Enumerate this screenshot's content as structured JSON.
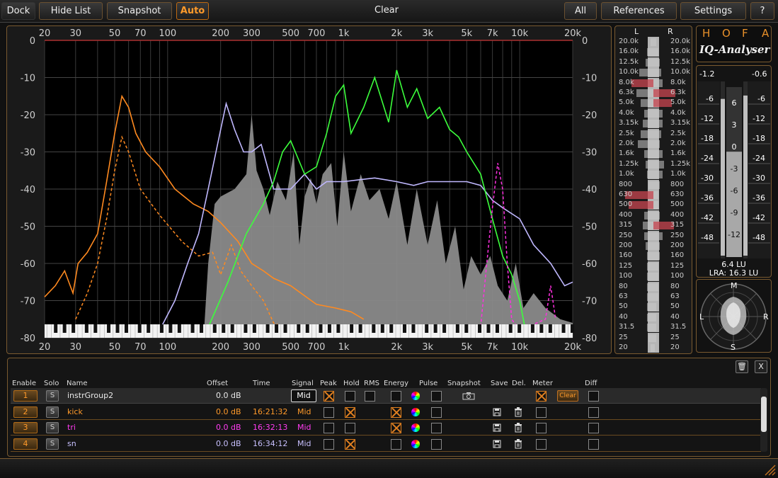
{
  "toolbar": {
    "dock": "Dock",
    "hide_list": "Hide List",
    "snapshot": "Snapshot",
    "auto": "Auto",
    "clear": "Clear",
    "all": "All",
    "references": "References",
    "settings": "Settings",
    "help": "?"
  },
  "analyzer": {
    "freq_labels": [
      "20",
      "30",
      "50",
      "70",
      "100",
      "200",
      "300",
      "500",
      "700",
      "1k",
      "2k",
      "3k",
      "5k",
      "7k",
      "10k",
      "20k"
    ],
    "db_labels": [
      "0",
      "-10",
      "-20",
      "-30",
      "-40",
      "-50",
      "-60",
      "-70",
      "-80"
    ]
  },
  "band_meter": {
    "left_label": "L",
    "right_label": "R",
    "bands": [
      "20.0k",
      "16.0k",
      "12.5k",
      "10.0k",
      "8.0k",
      "6.3k",
      "5.0k",
      "4.0k",
      "3.15k",
      "2.5k",
      "2.0k",
      "1.6k",
      "1.25k",
      "1.0k",
      "800",
      "630",
      "500",
      "400",
      "315",
      "250",
      "200",
      "160",
      "125",
      "100",
      "80",
      "63",
      "50",
      "40",
      "31.5",
      "25",
      "20"
    ],
    "left_levels": [
      0.1,
      0.2,
      0.25,
      0.45,
      0.7,
      0.55,
      0.4,
      0.3,
      0.35,
      0.4,
      0.5,
      0.3,
      0.25,
      0.2,
      0.15,
      0.9,
      0.8,
      0.3,
      0.35,
      0.3,
      0.25,
      0.2,
      0.2,
      0.2,
      0.2,
      0.2,
      0.2,
      0.2,
      0.2,
      0.15,
      0.1
    ],
    "right_levels": [
      0.1,
      0.15,
      0.2,
      0.25,
      0.3,
      0.7,
      0.6,
      0.3,
      0.3,
      0.25,
      0.2,
      0.3,
      0.35,
      0.3,
      0.2,
      0.15,
      0.15,
      0.2,
      0.65,
      0.3,
      0.2,
      0.2,
      0.15,
      0.15,
      0.15,
      0.15,
      0.1,
      0.1,
      0.1,
      0.1,
      0.05
    ],
    "left_peaks": [
      4,
      15,
      16
    ],
    "right_peaks": [
      5,
      6,
      18
    ]
  },
  "brand": {
    "letters": [
      "H",
      "O",
      "F",
      "A"
    ],
    "product": "IQ-Analyser"
  },
  "loudness": {
    "left_value": "-1.2",
    "right_value": "-0.6",
    "scale_outer": [
      "-6",
      "-12",
      "-18",
      "-24",
      "-30",
      "-36",
      "-42",
      "-48"
    ],
    "scale_inner": [
      "6",
      "3",
      "0",
      "-3",
      "-6",
      "-9",
      "-12"
    ],
    "lu_readout": "6.4 LU",
    "lra_readout": "LRA: 16.3 LU",
    "left_fill": 0.93,
    "right_fill": 0.95,
    "inner_fill": 0.62
  },
  "goniometer": {
    "m": "M",
    "s": "S",
    "l": "L",
    "r": "R"
  },
  "list": {
    "columns": [
      "Enable",
      "Solo",
      "Name",
      "Offset",
      "Time",
      "Signal",
      "Peak",
      "Hold",
      "RMS",
      "Energy",
      "Pulse",
      "Snapshot",
      "Save",
      "Del.",
      "Meter",
      "Diff"
    ],
    "trash": "🗑",
    "close": "X",
    "clear_label": "Clear",
    "solo_label": "S",
    "rows": [
      {
        "index": "1",
        "name": "instrGroup2",
        "offset": "0.0 dB",
        "time": "",
        "signal": "Mid",
        "color": "#e8e8e8"
      },
      {
        "index": "2",
        "name": "kick",
        "offset": "0.0 dB",
        "time": "16:21:32",
        "signal": "Mid",
        "color": "#ff9a2a"
      },
      {
        "index": "3",
        "name": "tri",
        "offset": "0.0 dB",
        "time": "16:32:13",
        "signal": "Mid",
        "color": "#ff3cf0"
      },
      {
        "index": "4",
        "name": "sn",
        "offset": "0.0 dB",
        "time": "16:34:12",
        "signal": "Mid",
        "color": "#c8c0ff"
      }
    ]
  },
  "colors": {
    "accent": "#ff9a2a",
    "kick": "#ff8a20",
    "tri": "#ff30e0",
    "sn": "#c0b8ff",
    "green": "#3cff3c",
    "fill": "#8a8a8a"
  }
}
